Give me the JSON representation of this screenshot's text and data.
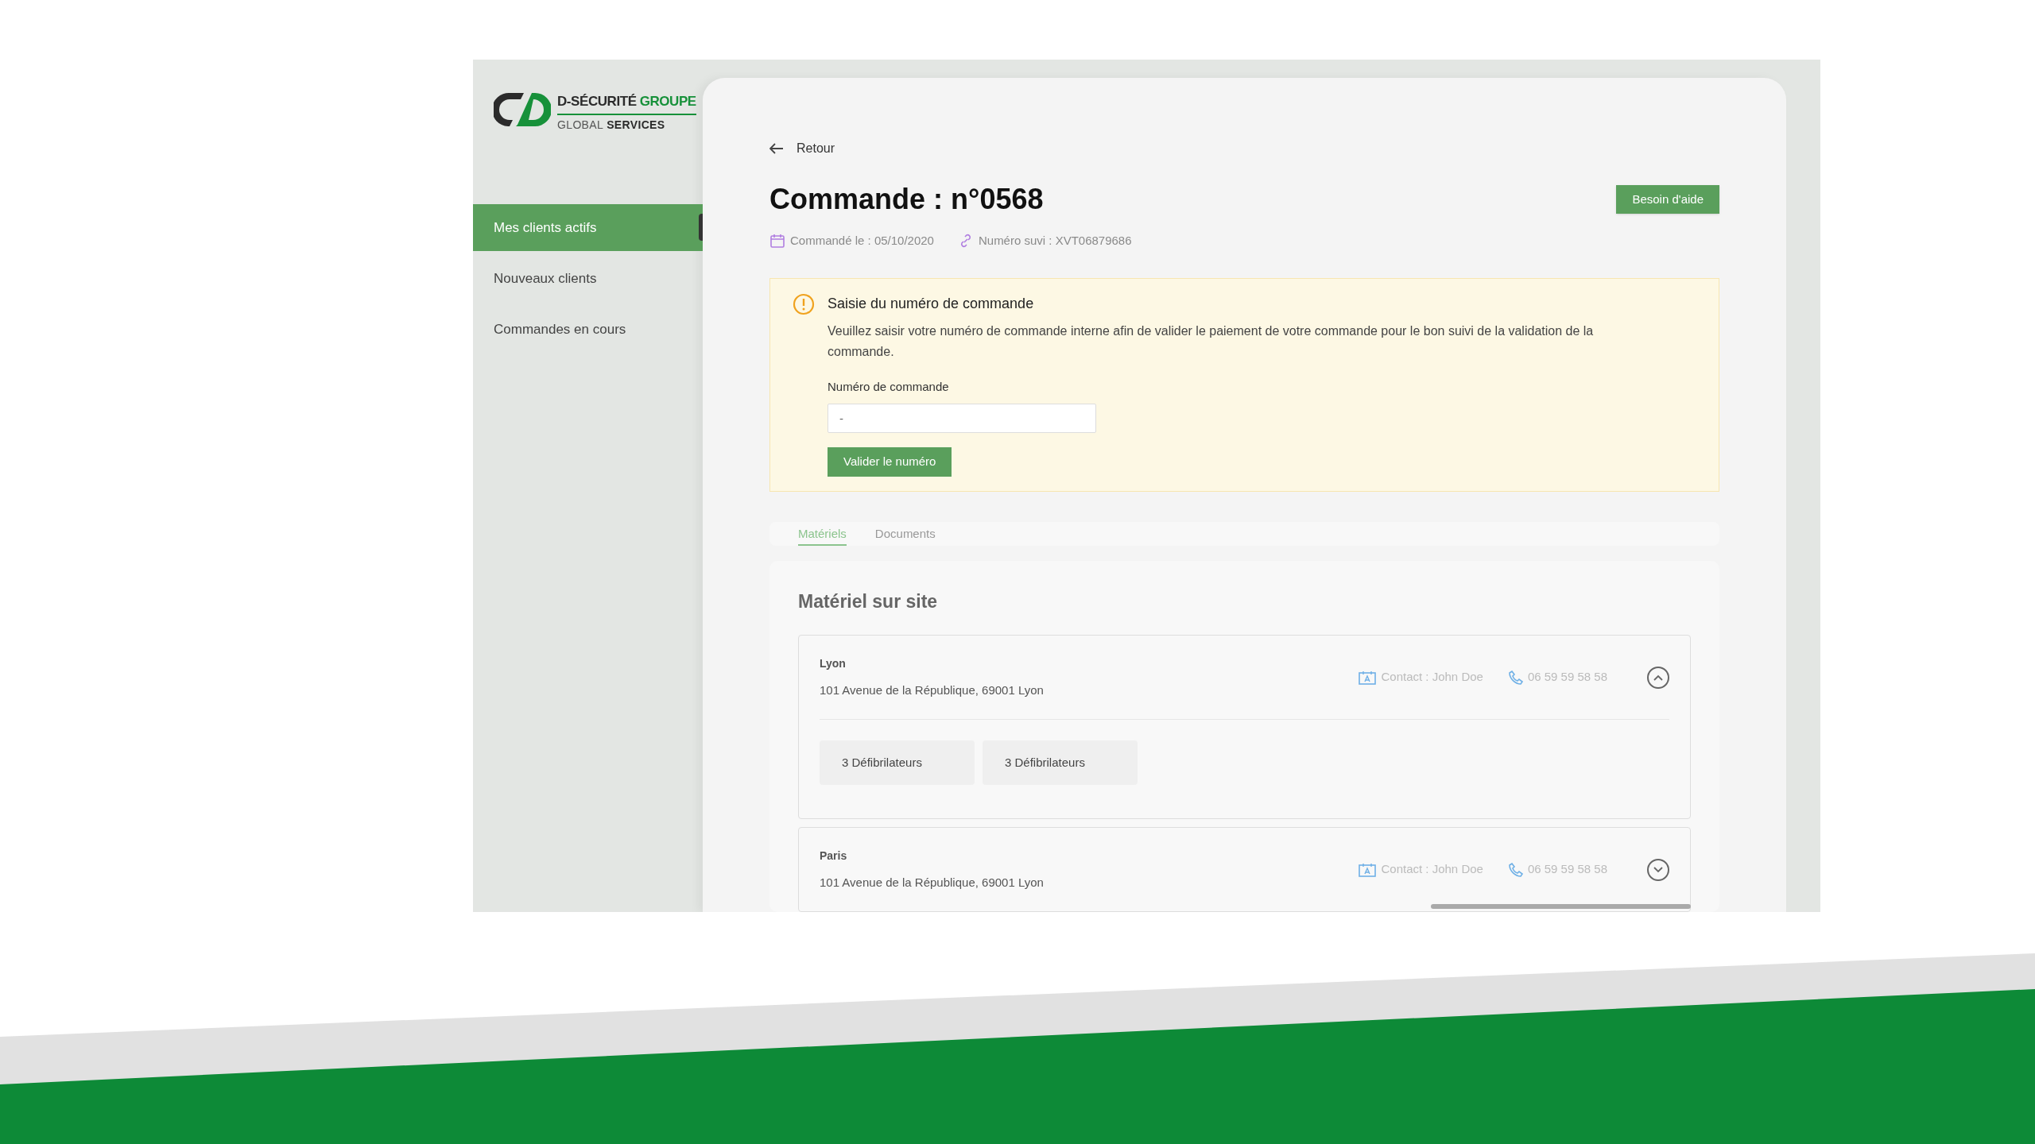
{
  "logo": {
    "brand": "D-SÉCURITÉ",
    "brand_accent": "GROUPE",
    "sub": "GLOBAL",
    "sub_bold": "SERVICES"
  },
  "sidebar": {
    "items": [
      {
        "label": "Mes clients actifs",
        "selected": true
      },
      {
        "label": "Nouveaux clients",
        "selected": false
      },
      {
        "label": "Commandes en cours",
        "selected": false
      }
    ]
  },
  "back_link": "Retour",
  "title": "Commande : n°0568",
  "help_button": "Besoin d'aide",
  "meta": [
    {
      "kind": "calendar",
      "text": "Commandé le : 05/10/2020"
    },
    {
      "kind": "link",
      "text": "Numéro suvi : XVT06879686"
    }
  ],
  "alert": {
    "title": "Saisie du numéro de commande",
    "message": "Veuillez saisir votre numéro de commande interne afin de valider le paiement de votre commande pour le bon suivi de la validation de la commande.",
    "field_label": "Numéro de commande",
    "field_value": "-",
    "button": "Valider le numéro"
  },
  "tabs": [
    {
      "label": "Matériels",
      "selected": true
    },
    {
      "label": "Documents",
      "selected": false
    }
  ],
  "section_title": "Matériel sur site",
  "sites": [
    {
      "name": "Lyon",
      "address": "101 Avenue de la République, 69001 Lyon",
      "contact": "Contact : John Doe",
      "phone": "06 59 59 58 58",
      "expanded": true,
      "items": [
        "3 Défibrilateurs",
        "3 Défibrilateurs"
      ]
    },
    {
      "name": "Paris",
      "address": "101 Avenue de la République, 69001 Lyon",
      "contact": "Contact : John Doe",
      "phone": "06 59 59 58 58",
      "expanded": false
    }
  ]
}
